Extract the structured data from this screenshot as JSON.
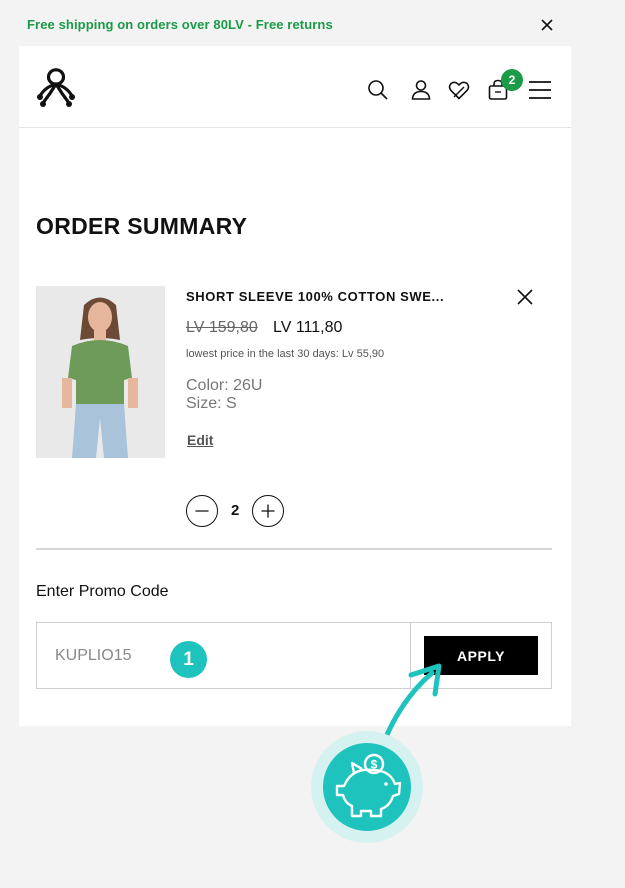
{
  "announcement": {
    "text": "Free shipping on orders over 80LV - Free returns"
  },
  "header": {
    "cart_count": "2"
  },
  "order_summary": {
    "title": "ORDER SUMMARY"
  },
  "item": {
    "name": "SHORT SLEEVE 100% COTTON SWE...",
    "old_price": "LV 159,80",
    "new_price": "LV 111,80",
    "lowest_price_note": "lowest price in the last 30 days: Lv 55,90",
    "color": "Color: 26U",
    "size": "Size: S",
    "edit_label": "Edit",
    "quantity": "2"
  },
  "promo": {
    "label": "Enter Promo Code",
    "code_value": "KUPLIO15",
    "step_number": "1",
    "apply_label": "APPLY"
  },
  "colors": {
    "brand_green": "#1b9a48",
    "teal_accent": "#1ec3be",
    "button_black": "#000000"
  },
  "icons": [
    "close-icon",
    "benetton-logo",
    "search-icon",
    "account-icon",
    "wishlist-icon",
    "cart-icon",
    "menu-icon",
    "minus-icon",
    "plus-icon",
    "piggy-bank-icon",
    "arrow-icon"
  ]
}
